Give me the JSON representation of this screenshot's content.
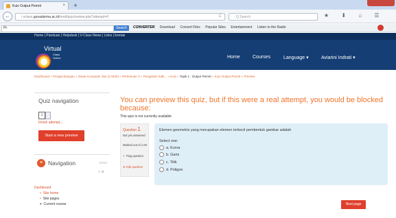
{
  "browser": {
    "tab_title": "Kuis Output Pemrit",
    "tab_close": "×",
    "new_tab": "+",
    "url_prefix": "i  vclass.",
    "url_domain": "gunadarma.ac.id",
    "url_path": "/mod/quiz/review.php?attempt=0",
    "search_placeholder": "Q Search",
    "nav_icons": "★ ⬇ ⌂ ☰",
    "addr_value": "Pl-",
    "search_button": "Search",
    "toolbar_items": [
      "CONVERTER",
      "Download",
      "Convert Files",
      "Popular Sites",
      "Entertainment",
      "Listen to the Radio"
    ]
  },
  "site": {
    "top_links": "Home | Panduan | Helpdesk | V-Class News | Links | kontak",
    "logo_name": "Virtual",
    "logo_sub1": "Class",
    "logo_sub2": "Online",
    "nav": [
      "Home",
      "Courses",
      "Language ▾",
      "Aviarini Indrati ▾"
    ]
  },
  "breadcrumb": {
    "trail": "Dashboard » Pengembangan » Dasar-Komputer dan (2 IB20) » Pertemuan 3 » Pengantar Kalk... » Kuis » ",
    "current": "Topik 1 : Output Pemrit",
    "tail": " » Kuis Output Pemrit » Preview"
  },
  "quiz_nav": {
    "heading": "Quiz navigation",
    "box": "1",
    "finish": "Finish attempt...",
    "start_button": "Start a new preview"
  },
  "navigation": {
    "heading": "Navigation",
    "items": [
      {
        "text": "Dashboard",
        "cls": "l0"
      },
      {
        "text": "Site home",
        "cls": "b link"
      },
      {
        "text": "Site pages",
        "cls": "b"
      },
      {
        "text": "Current course",
        "cls": "c"
      }
    ]
  },
  "main": {
    "message": "You can preview this quiz, but if this were a real attempt, you would be blocked because:",
    "sub": "This quiz is not currently available",
    "question_label": "Question",
    "question_number": "1",
    "state": "Not yet answered",
    "marks": "Marked out of 1.00",
    "flag": "Flag question",
    "edit": "Edit question",
    "question_text": "Elemen geometris yang merupakan elemen terkecil pembentuk gambar adalah",
    "select_one": "Select one:",
    "options": [
      "a. Kurva",
      "b. Garis",
      "c. Titik",
      "d. Poligon"
    ],
    "next_button": "Next page"
  }
}
